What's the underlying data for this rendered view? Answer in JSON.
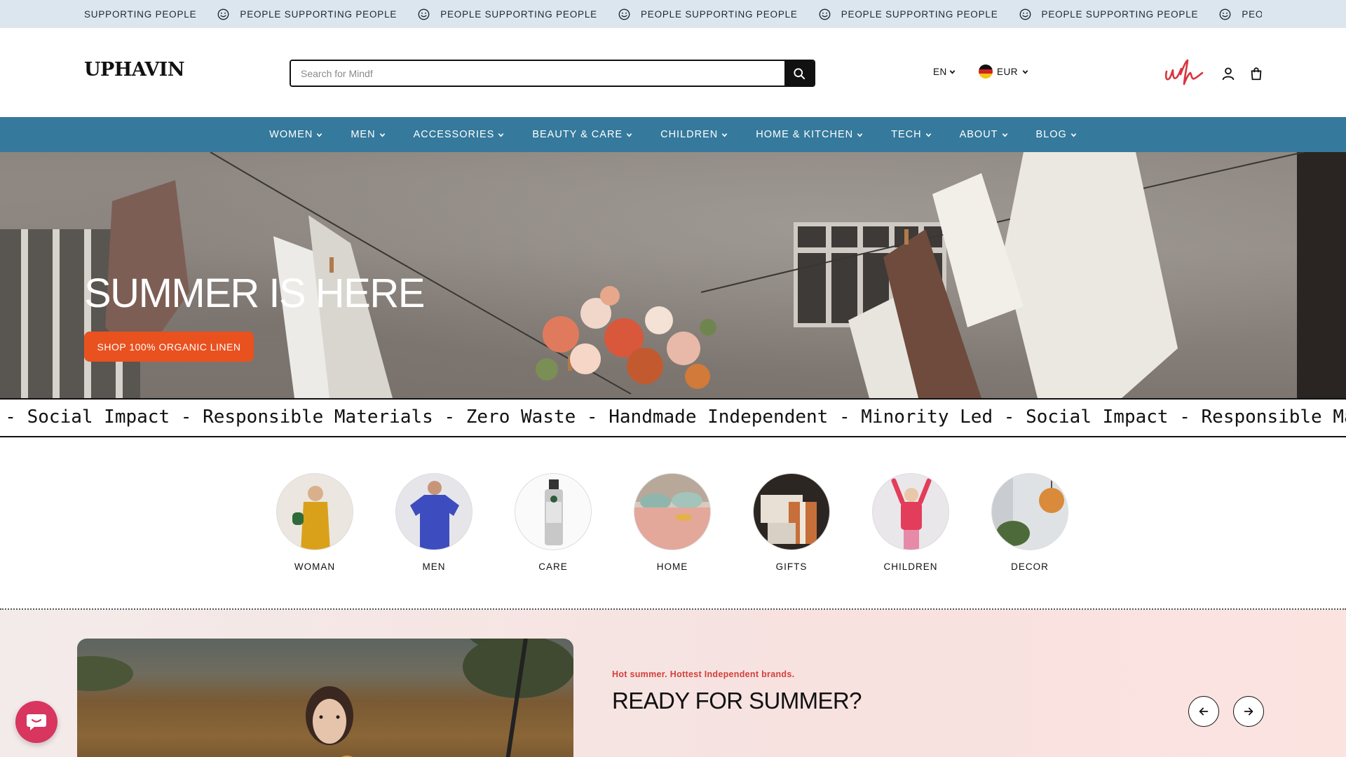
{
  "announcement": {
    "lead": "SUPPORTING PEOPLE",
    "items": [
      "PEOPLE SUPPORTING PEOPLE",
      "PEOPLE SUPPORTING PEOPLE",
      "PEOPLE SUPPORTING PEOPLE",
      "PEOPLE SUPPORTING PEOPLE",
      "PEOPLE SUPPORTING PEOPLE",
      "PEOPLE SUPPORTING PEOPLE"
    ]
  },
  "header": {
    "logo": "UPHAVIN",
    "search_placeholder": "Search for Mindf",
    "language": "EN",
    "currency": "EUR"
  },
  "nav": {
    "items": [
      "WOMEN",
      "MEN",
      "ACCESSORIES",
      "BEAUTY & CARE",
      "CHILDREN",
      "HOME & KITCHEN",
      "TECH",
      "ABOUT",
      "BLOG"
    ]
  },
  "hero": {
    "title": "SUMMER IS HERE",
    "cta": "SHOP 100% ORGANIC LINEN"
  },
  "values": {
    "text": "d - Social Impact - Responsible Materials - Zero Waste - Handmade   Independent - Minority Led - Social Impact - Responsible Mate"
  },
  "categories": [
    "WOMAN",
    "MEN",
    "CARE",
    "HOME",
    "GIFTS",
    "CHILDREN",
    "DECOR"
  ],
  "promo": {
    "kicker": "Hot summer. Hottest Independent brands.",
    "title": "READY FOR SUMMER?"
  },
  "colors": {
    "announcement_bg": "#dce6ee",
    "nav_bg": "#35799c",
    "cta": "#e9511f",
    "kicker": "#d2403b",
    "chat": "#d8355f"
  }
}
